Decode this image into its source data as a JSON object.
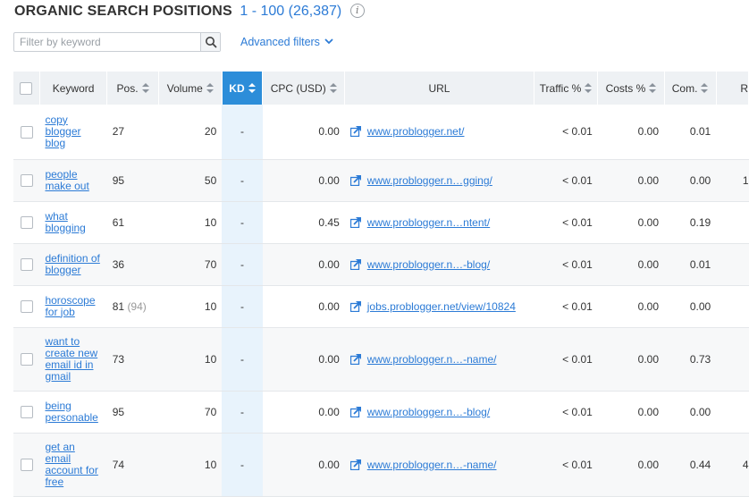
{
  "header": {
    "title": "ORGANIC SEARCH POSITIONS",
    "range": "1 - 100 (26,387)",
    "info": "i"
  },
  "filter": {
    "placeholder": "Filter by keyword",
    "value": ""
  },
  "advanced_filters": "Advanced filters",
  "columns": {
    "keyword": "Keyword",
    "pos": "Pos.",
    "volume": "Volume",
    "kd": "KD",
    "cpc": "CPC (USD)",
    "url": "URL",
    "traffic": "Traffic %",
    "costs": "Costs %",
    "com": "Com.",
    "extra": "R"
  },
  "rows": [
    {
      "keyword": "copy blogger blog",
      "pos": "27",
      "pos_prev": "",
      "volume": "20",
      "kd": "-",
      "cpc": "0.00",
      "url": "www.problogger.net/",
      "traffic": "< 0.01",
      "costs": "0.00",
      "com": "0.01",
      "extra": ""
    },
    {
      "keyword": "people make out",
      "pos": "95",
      "pos_prev": "",
      "volume": "50",
      "kd": "-",
      "cpc": "0.00",
      "url": "www.problogger.n…gging/",
      "traffic": "< 0.01",
      "costs": "0.00",
      "com": "0.00",
      "extra": "1"
    },
    {
      "keyword": "what blogging",
      "pos": "61",
      "pos_prev": "",
      "volume": "10",
      "kd": "-",
      "cpc": "0.45",
      "url": "www.problogger.n…ntent/",
      "traffic": "< 0.01",
      "costs": "0.00",
      "com": "0.19",
      "extra": ""
    },
    {
      "keyword": "definition of blogger",
      "pos": "36",
      "pos_prev": "",
      "volume": "70",
      "kd": "-",
      "cpc": "0.00",
      "url": "www.problogger.n…-blog/",
      "traffic": "< 0.01",
      "costs": "0.00",
      "com": "0.01",
      "extra": ""
    },
    {
      "keyword": "horoscope for job",
      "pos": "81",
      "pos_prev": "(94)",
      "volume": "10",
      "kd": "-",
      "cpc": "0.00",
      "url": "jobs.problogger.net/view/10824",
      "traffic": "< 0.01",
      "costs": "0.00",
      "com": "0.00",
      "extra": ""
    },
    {
      "keyword": "want to create new email id in gmail",
      "pos": "73",
      "pos_prev": "",
      "volume": "10",
      "kd": "-",
      "cpc": "0.00",
      "url": "www.problogger.n…-name/",
      "traffic": "< 0.01",
      "costs": "0.00",
      "com": "0.73",
      "extra": ""
    },
    {
      "keyword": "being personable",
      "pos": "95",
      "pos_prev": "",
      "volume": "70",
      "kd": "-",
      "cpc": "0.00",
      "url": "www.problogger.n…-blog/",
      "traffic": "< 0.01",
      "costs": "0.00",
      "com": "0.00",
      "extra": ""
    },
    {
      "keyword": "get an email account for free",
      "pos": "74",
      "pos_prev": "",
      "volume": "10",
      "kd": "-",
      "cpc": "0.00",
      "url": "www.problogger.n…-name/",
      "traffic": "< 0.01",
      "costs": "0.00",
      "com": "0.44",
      "extra": "4"
    }
  ]
}
